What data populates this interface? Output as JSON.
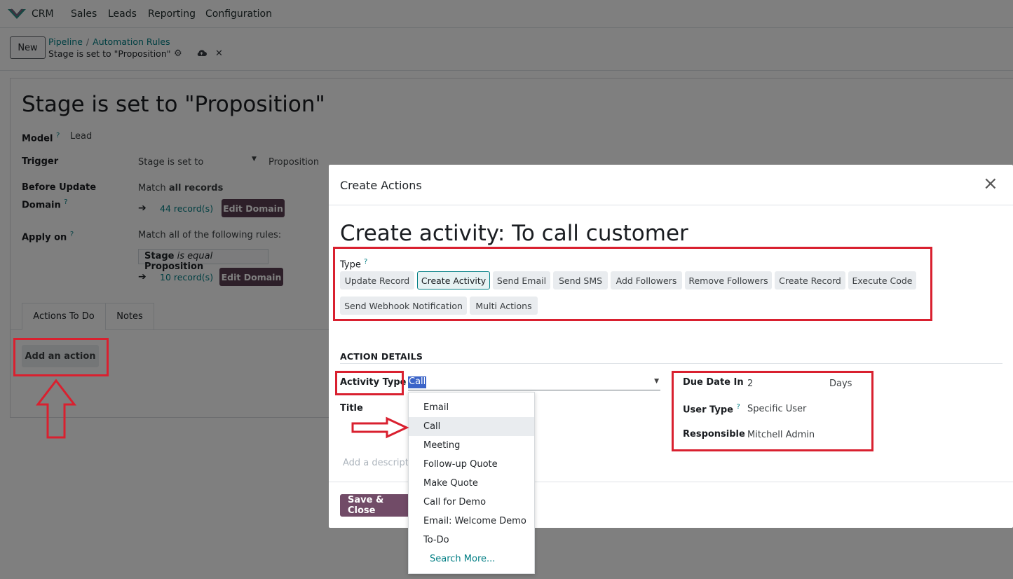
{
  "nav": {
    "app_name": "CRM",
    "menu": [
      "Sales",
      "Leads",
      "Reporting",
      "Configuration"
    ]
  },
  "control_panel": {
    "new_label": "New",
    "breadcrumb": [
      "Pipeline",
      "Automation Rules"
    ],
    "breadcrumb_sep": "/",
    "current": "Stage is set to \"Proposition\""
  },
  "form": {
    "title": "Stage is set to \"Proposition\"",
    "model_label": "Model",
    "model_value": "Lead",
    "trigger_label": "Trigger",
    "trigger_value": "Stage is set to",
    "trigger_stage": "Proposition",
    "before_update_label_1": "Before Update",
    "before_update_label_2": "Domain",
    "match_prefix": "Match",
    "match_all": "all records",
    "records_1": "44 record(s)",
    "edit_domain": "Edit Domain",
    "apply_on_label": "Apply on",
    "apply_rules": "Match all of the following rules:",
    "rule_field": "Stage",
    "rule_op": "is equal",
    "rule_value": "Proposition",
    "records_2": "10 record(s)",
    "help_mark": "?"
  },
  "tabs": [
    "Actions To Do",
    "Notes"
  ],
  "add_action_label": "Add an action",
  "modal": {
    "title": "Create Actions",
    "close_glyph": "×",
    "heading": "Create activity: To call customer",
    "type_label": "Type",
    "types": [
      "Update Record",
      "Create Activity",
      "Send Email",
      "Send SMS",
      "Add Followers",
      "Remove Followers",
      "Create Record",
      "Execute Code",
      "Send Webhook Notification",
      "Multi Actions"
    ],
    "selected_type": "Create Activity",
    "section_title": "ACTION DETAILS",
    "activity_type_label": "Activity Type",
    "activity_type_value": "Call",
    "title_label": "Title",
    "description_placeholder": "Add a description",
    "due_date_label": "Due Date In",
    "due_date_value": "2",
    "due_date_unit": "Days",
    "user_type_label": "User Type",
    "user_type_value": "Specific User",
    "responsible_label": "Responsible",
    "responsible_value": "Mitchell Admin",
    "save_close_label": "Save & Close"
  },
  "dropdown": {
    "items": [
      "Email",
      "Call",
      "Meeting",
      "Follow-up Quote",
      "Make Quote",
      "Call for Demo",
      "Email: Welcome Demo",
      "To-Do"
    ],
    "hovered": "Call",
    "search_more": "Search More..."
  },
  "colors": {
    "accent_teal": "#017e84",
    "brand_purple": "#714b67",
    "annotation_red": "#d9202f"
  }
}
